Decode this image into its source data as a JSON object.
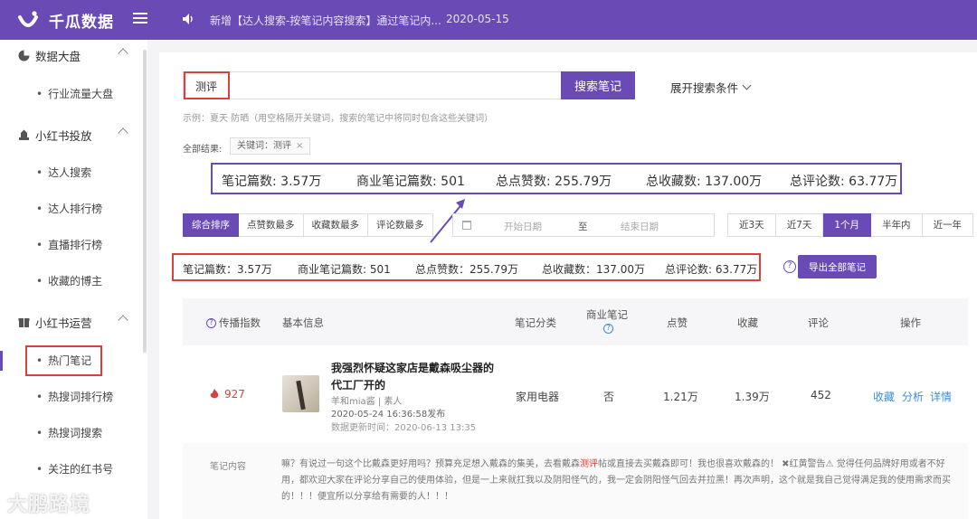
{
  "app": {
    "name": "千瓜数据"
  },
  "notice": {
    "text": "新增【达人搜索-按笔记内容搜索】通过笔记内...",
    "date": "2020-05-15"
  },
  "sidebar": {
    "groups": [
      {
        "label": "数据大盘",
        "items": [
          "行业流量大盘"
        ]
      },
      {
        "label": "小红书投放",
        "items": [
          "达人搜索",
          "达人排行榜",
          "直播排行榜",
          "收藏的博主"
        ]
      },
      {
        "label": "小红书运营",
        "items": [
          "热门笔记",
          "热搜词排行榜",
          "热搜词搜索",
          "关注的红书号"
        ]
      }
    ]
  },
  "search": {
    "value": "测评",
    "button": "搜索笔记",
    "expand": "展开搜索条件",
    "hint": "示例：夏天 防晒（用空格隔开关键词，搜索的笔记中将同时包含这些关键词）",
    "all_results_label": "全部结果:",
    "tag": "关键词：测评",
    "tag_close": "×"
  },
  "callout": {
    "notes": "笔记篇数: 3.57万",
    "commercial": "商业笔记篇数: 501",
    "likes": "总点赞数: 255.79万",
    "collects": "总收藏数: 137.00万",
    "comments": "总评论数: 63.77万"
  },
  "sort": {
    "tabs": [
      "综合排序",
      "点赞数最多",
      "收藏数最多",
      "评论数最多"
    ],
    "active": 0
  },
  "date": {
    "start": "开始日期",
    "to": "至",
    "end": "结束日期"
  },
  "range": {
    "tabs": [
      "近3天",
      "近7天",
      "1个月",
      "半年内",
      "近一年"
    ],
    "active": 2
  },
  "stats": {
    "notes": "笔记篇数：3.57万",
    "commercial": "商业笔记篇数: 501",
    "likes": "总点赞数：255.79万",
    "collects": "总收藏数：137.00万",
    "comments": "总评论数: 63.77万"
  },
  "export": {
    "label": "导出全部笔记",
    "help": "?"
  },
  "table": {
    "headers": {
      "spread": "传播指数",
      "info": "基本信息",
      "category": "笔记分类",
      "commercial": "商业笔记",
      "likes": "点赞",
      "collects": "收藏",
      "comments": "评论",
      "actions": "操作"
    },
    "row": {
      "score": "927",
      "title": "我强烈怀疑这家店是戴森吸尘器的代工厂开的",
      "author": "羊和mia酱 | 素人",
      "published": "2020-05-24 16:36:58发布",
      "updated": "数据更新时间：2020-06-13 13:35",
      "category": "家用电器",
      "commercial": "否",
      "likes": "1.21万",
      "collects": "1.39万",
      "comments": "452",
      "actions": [
        "收藏",
        "分析",
        "详情"
      ]
    },
    "note_label": "笔记内容",
    "note_before": "嘛？有说过一句这个比戴森更好用吗？预算充足想入戴森的集美，去看戴森",
    "note_keyword": "测评",
    "note_after": "帖或直接去买戴森即可！我也很喜欢戴森的！ ✖红黄警告⚠ 觉得任何品牌好用或者不好用，都欢迎大家在评论分享自己的使用体验，但是一上来就扛我以及阴阳怪气的，我一定会阴阳怪气回去并拉黑！再次声明，这个就是我自己觉得满足我的使用需求而买的！！！便宜所以分享给有需要的人！！！"
  },
  "watermark": "大鹏路境",
  "colors": {
    "brand": "#6a4bb5",
    "highlight": "#d94040",
    "link": "#3b8ed8"
  }
}
